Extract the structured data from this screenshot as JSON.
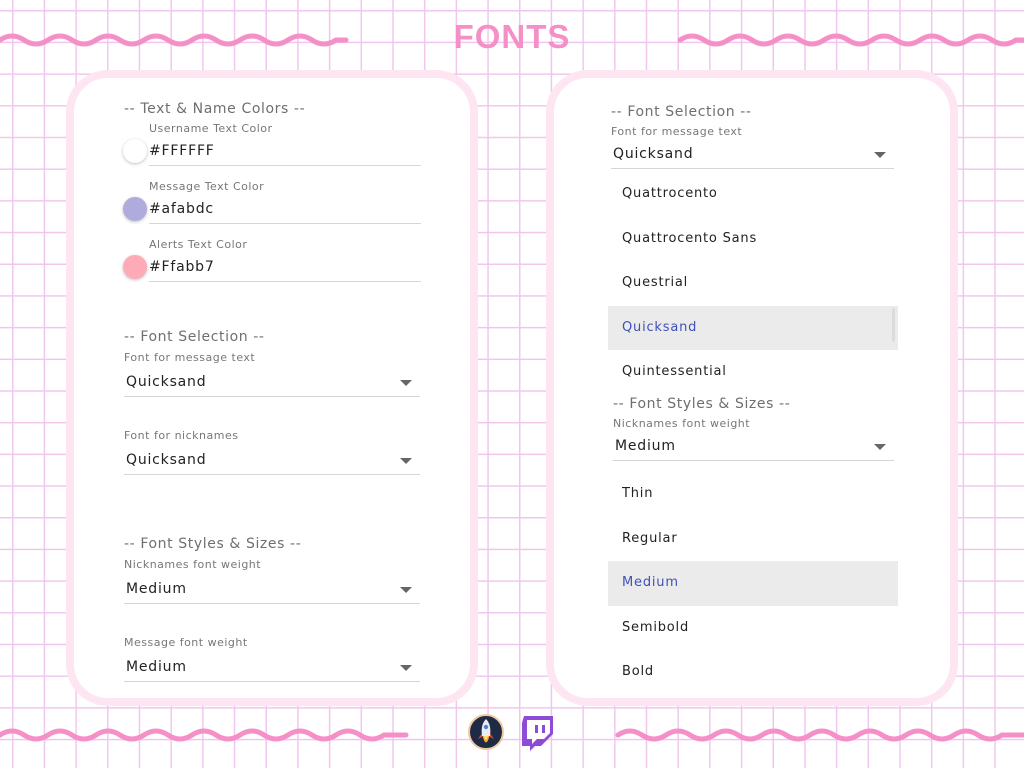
{
  "page": {
    "title": "FONTS"
  },
  "colors": {
    "accent": "#f490c7",
    "grid": "#f1c6ee",
    "card_border": "#fde6f1",
    "selected_text": "#3f51b5",
    "twitch": "#8e4bd6"
  },
  "left_panel": {
    "text_colors": {
      "heading": "-- Text & Name Colors --",
      "username": {
        "label": "Username Text Color",
        "value": "#FFFFFF",
        "swatch": "#ffffff"
      },
      "message": {
        "label": "Message Text Color",
        "value": "#afabdc",
        "swatch": "#afabdc"
      },
      "alerts": {
        "label": "Alerts Text Color",
        "value": "#Ffabb7",
        "swatch": "#ffabb7"
      }
    },
    "font_selection": {
      "heading": "-- Font Selection --",
      "message_font": {
        "label": "Font for message text",
        "value": "Quicksand"
      },
      "nickname_font": {
        "label": "Font for nicknames",
        "value": "Quicksand"
      }
    },
    "font_styles": {
      "heading": "-- Font Styles & Sizes --",
      "nickname_weight": {
        "label": "Nicknames font weight",
        "value": "Medium"
      },
      "message_weight": {
        "label": "Message font weight",
        "value": "Medium"
      }
    }
  },
  "right_panel": {
    "font_selection": {
      "heading": "-- Font Selection --",
      "message_font": {
        "label": "Font for message text",
        "value": "Quicksand"
      },
      "options": [
        "Quattrocento",
        "Quattrocento Sans",
        "Questrial",
        "Quicksand",
        "Quintessential"
      ],
      "selected": "Quicksand"
    },
    "font_styles": {
      "heading": "-- Font Styles & Sizes --",
      "nickname_weight": {
        "label": "Nicknames font weight",
        "value": "Medium"
      },
      "options": [
        "Thin",
        "Regular",
        "Medium",
        "Semibold",
        "Bold"
      ],
      "selected": "Medium"
    }
  },
  "footer": {
    "icons": [
      "rocket-app-icon",
      "twitch-icon"
    ]
  }
}
